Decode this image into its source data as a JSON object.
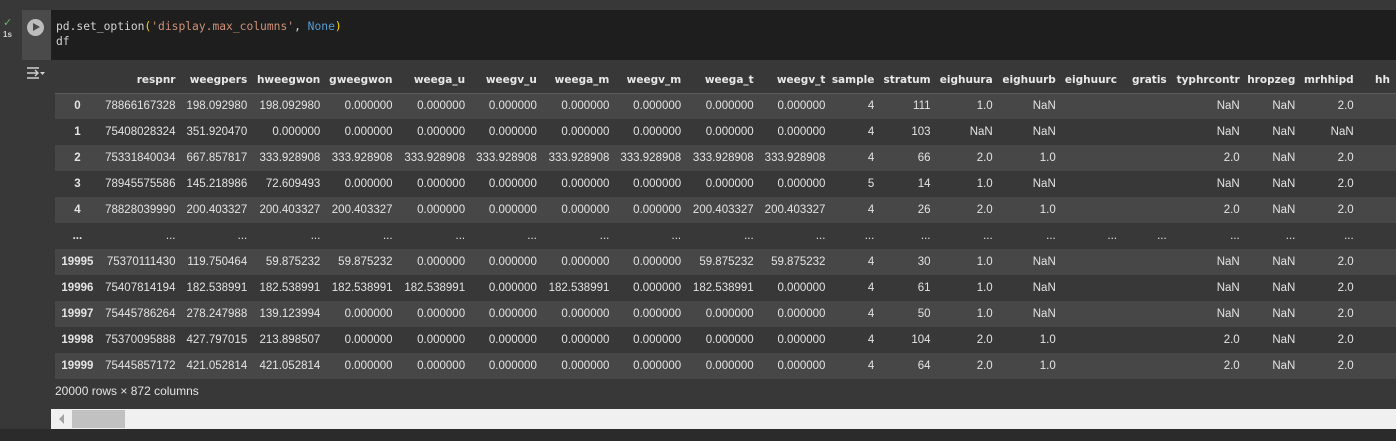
{
  "cell": {
    "status": "✓",
    "exec_time": "1s",
    "code_line1": {
      "fn": "pd.set_option",
      "open": "(",
      "arg1": "'display.max_columns'",
      "sep": ", ",
      "arg2": "None",
      "close": ")"
    },
    "code_line2": "df"
  },
  "output": {
    "columns": [
      "",
      "respnr",
      "weegpers",
      "hweegwon",
      "gweegwon",
      "weega_u",
      "weegv_u",
      "weega_m",
      "weegv_m",
      "weega_t",
      "weegv_t",
      "sample",
      "stratum",
      "eighuura",
      "eighuurb",
      "eighuurc",
      "gratis",
      "typhrcontr",
      "hropzeg",
      "mrhhipd",
      "hh"
    ],
    "rows": [
      [
        "0",
        "78866167328",
        "198.092980",
        "198.092980",
        "0.000000",
        "0.000000",
        "0.000000",
        "0.000000",
        "0.000000",
        "0.000000",
        "0.000000",
        "4",
        "111",
        "1.0",
        "NaN",
        "",
        "",
        "NaN",
        "NaN",
        "2.0",
        ""
      ],
      [
        "1",
        "75408028324",
        "351.920470",
        "0.000000",
        "0.000000",
        "0.000000",
        "0.000000",
        "0.000000",
        "0.000000",
        "0.000000",
        "0.000000",
        "4",
        "103",
        "NaN",
        "NaN",
        "",
        "",
        "NaN",
        "NaN",
        "NaN",
        ""
      ],
      [
        "2",
        "75331840034",
        "667.857817",
        "333.928908",
        "333.928908",
        "333.928908",
        "333.928908",
        "333.928908",
        "333.928908",
        "333.928908",
        "333.928908",
        "4",
        "66",
        "2.0",
        "1.0",
        "",
        "",
        "2.0",
        "NaN",
        "2.0",
        ""
      ],
      [
        "3",
        "78945575586",
        "145.218986",
        "72.609493",
        "0.000000",
        "0.000000",
        "0.000000",
        "0.000000",
        "0.000000",
        "0.000000",
        "0.000000",
        "5",
        "14",
        "1.0",
        "NaN",
        "",
        "",
        "NaN",
        "NaN",
        "2.0",
        ""
      ],
      [
        "4",
        "78828039990",
        "200.403327",
        "200.403327",
        "200.403327",
        "0.000000",
        "0.000000",
        "0.000000",
        "0.000000",
        "200.403327",
        "200.403327",
        "4",
        "26",
        "2.0",
        "1.0",
        "",
        "",
        "2.0",
        "NaN",
        "2.0",
        ""
      ],
      [
        "...",
        "...",
        "...",
        "...",
        "...",
        "...",
        "...",
        "...",
        "...",
        "...",
        "...",
        "...",
        "...",
        "...",
        "...",
        "...",
        "...",
        "...",
        "...",
        "...",
        ""
      ],
      [
        "19995",
        "75370111430",
        "119.750464",
        "59.875232",
        "59.875232",
        "0.000000",
        "0.000000",
        "0.000000",
        "0.000000",
        "59.875232",
        "59.875232",
        "4",
        "30",
        "1.0",
        "NaN",
        "",
        "",
        "NaN",
        "NaN",
        "2.0",
        ""
      ],
      [
        "19996",
        "75407814194",
        "182.538991",
        "182.538991",
        "182.538991",
        "182.538991",
        "0.000000",
        "182.538991",
        "0.000000",
        "182.538991",
        "0.000000",
        "4",
        "61",
        "1.0",
        "NaN",
        "",
        "",
        "NaN",
        "NaN",
        "2.0",
        ""
      ],
      [
        "19997",
        "75445786264",
        "278.247988",
        "139.123994",
        "0.000000",
        "0.000000",
        "0.000000",
        "0.000000",
        "0.000000",
        "0.000000",
        "0.000000",
        "4",
        "50",
        "1.0",
        "NaN",
        "",
        "",
        "NaN",
        "NaN",
        "2.0",
        ""
      ],
      [
        "19998",
        "75370095888",
        "427.797015",
        "213.898507",
        "0.000000",
        "0.000000",
        "0.000000",
        "0.000000",
        "0.000000",
        "0.000000",
        "0.000000",
        "4",
        "104",
        "2.0",
        "1.0",
        "",
        "",
        "2.0",
        "NaN",
        "2.0",
        ""
      ],
      [
        "19999",
        "75445857172",
        "421.052814",
        "421.052814",
        "0.000000",
        "0.000000",
        "0.000000",
        "0.000000",
        "0.000000",
        "0.000000",
        "0.000000",
        "4",
        "64",
        "2.0",
        "1.0",
        "",
        "",
        "2.0",
        "NaN",
        "2.0",
        ""
      ]
    ],
    "shape_text": "20000 rows × 872 columns"
  },
  "icons": {
    "run": "play-circle-icon",
    "output_menu": "output-actions-icon",
    "status": "check-icon"
  }
}
